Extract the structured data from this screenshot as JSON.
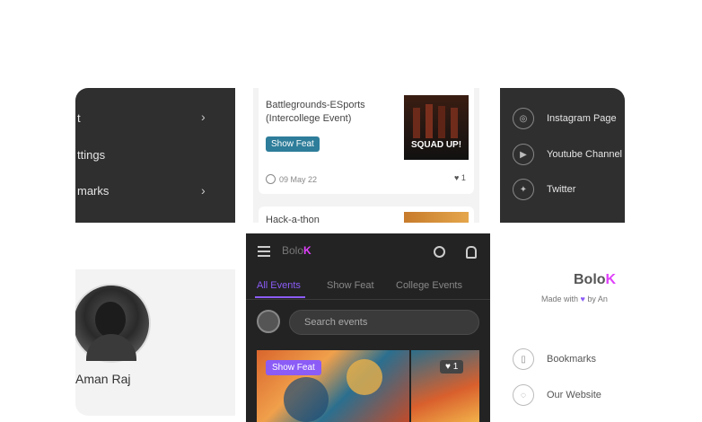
{
  "left_menu": {
    "items": [
      {
        "label": "t",
        "has_chevron": true
      },
      {
        "label": "ttings",
        "has_chevron": false
      },
      {
        "label": "marks",
        "has_chevron": true
      }
    ]
  },
  "event_list": {
    "item1": {
      "title_line1": "Battlegrounds-ESports",
      "title_line2": "(Intercollege Event)",
      "badge": "Show Feat",
      "date": "09 May 22",
      "likes": "1",
      "poster_text": "SQUAD UP!"
    },
    "item2": {
      "title_partial": "Hack-a-thon"
    }
  },
  "social_menu": {
    "items": [
      {
        "label": "Instagram Page",
        "icon": "instagram-icon"
      },
      {
        "label": "Youtube Channel",
        "icon": "youtube-icon"
      },
      {
        "label": "Twitter",
        "icon": "twitter-icon"
      }
    ]
  },
  "profile": {
    "name": "Aman Raj"
  },
  "app": {
    "logo_text": "Bolo",
    "logo_accent": "K",
    "tabs": [
      "All Events",
      "Show Feat",
      "College Events"
    ],
    "active_tab": "All Events",
    "search_placeholder": "Search events",
    "card_badge": "Show Feat",
    "card_likes": "1"
  },
  "about": {
    "logo_text": "Bolo",
    "logo_accent": "K",
    "tagline_prefix": "Made with",
    "tagline_suffix": "by An",
    "items": [
      {
        "label": "Bookmarks",
        "icon": "bookmark-icon"
      },
      {
        "label": "Our Website",
        "icon": "globe-icon"
      }
    ]
  },
  "colors": {
    "accent": "#8b5cf6",
    "logo_accent": "#e040fb",
    "badge_bg": "#2e7d9a",
    "dark_bg": "#2f2f2f"
  }
}
